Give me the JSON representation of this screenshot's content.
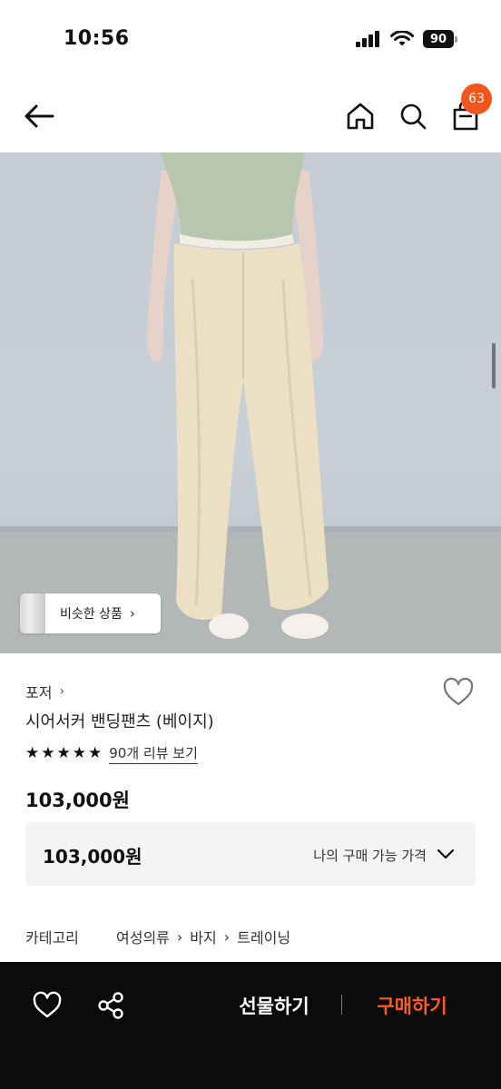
{
  "status_bar": {
    "time": "10:56",
    "battery": "90"
  },
  "nav": {
    "cart_badge": "63"
  },
  "image": {
    "similar_products_label": "비슷한 상품"
  },
  "product": {
    "brand": "포저",
    "name": "시어서커 밴딩팬츠 (베이지)",
    "rating_stars": 5,
    "review_link": "90개 리뷰 보기",
    "price": "103,000원"
  },
  "buy_price": {
    "value": "103,000원",
    "label": "나의 구매 가능 가격"
  },
  "category": {
    "label": "카테고리",
    "path": [
      "여성의류",
      "바지",
      "트레이닝"
    ]
  },
  "bottom_bar": {
    "gift_label": "선물하기",
    "buy_label": "구매하기"
  },
  "colors": {
    "accent": "#f2561d",
    "buy": "#ff5a1f",
    "bottom_bar": "#0b0b0b"
  }
}
